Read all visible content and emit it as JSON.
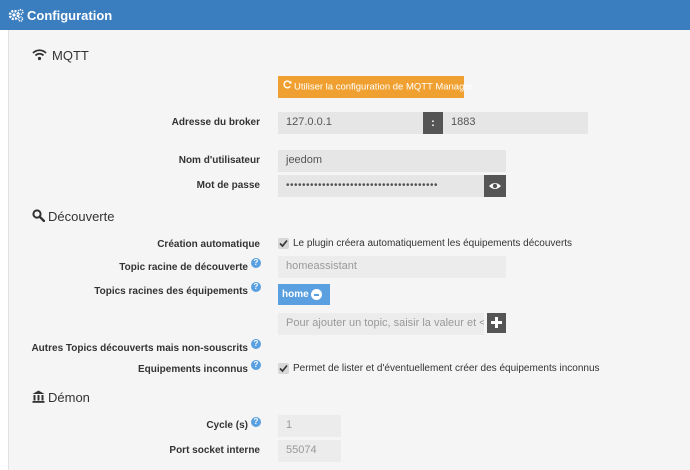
{
  "header": {
    "title": "Configuration",
    "icon": "gears-icon"
  },
  "sections": {
    "mqtt": {
      "title": "MQTT",
      "icon": "wifi-icon"
    },
    "discovery": {
      "title": "Découverte",
      "icon": "search-icon"
    },
    "daemon": {
      "title": "Démon",
      "icon": "institution-icon"
    }
  },
  "mqtt_manager_button": {
    "label": "Utiliser la configuration de MQTT Manager",
    "icon": "refresh-icon",
    "color": "#f0a030"
  },
  "broker": {
    "label": "Adresse du broker",
    "host": "127.0.0.1",
    "separator": ":",
    "port": "1883"
  },
  "username": {
    "label": "Nom d'utilisateur",
    "value": "jeedom"
  },
  "password": {
    "label": "Mot de passe",
    "value": "••••••••••••••••••••••••••••••••••••••",
    "toggle_icon": "eye-icon"
  },
  "auto_creation": {
    "label": "Création automatique",
    "checked": true,
    "description": "Le plugin créera automatiquement les équipements découverts"
  },
  "discovery_root_topic": {
    "label": "Topic racine de découverte",
    "value": "homeassistant"
  },
  "equipment_root_topics": {
    "label": "Topics racines des équipements",
    "tags": [
      "home"
    ],
    "placeholder": "Pour ajouter un topic, saisir la valeur et <Ent",
    "add_icon": "plus-icon"
  },
  "other_topics": {
    "label": "Autres Topics découverts mais non-souscrits"
  },
  "unknown_equipment": {
    "label": "Equipements inconnus",
    "checked": true,
    "description": "Permet de lister et d'éventuellement créer des équipements inconnus"
  },
  "cycle": {
    "label": "Cycle (s)",
    "value": "1"
  },
  "socket_port": {
    "label": "Port socket interne",
    "value": "55074"
  },
  "colors": {
    "header": "#3a7ebf",
    "tag": "#5aa0e0",
    "help": "#5aa0e0"
  }
}
